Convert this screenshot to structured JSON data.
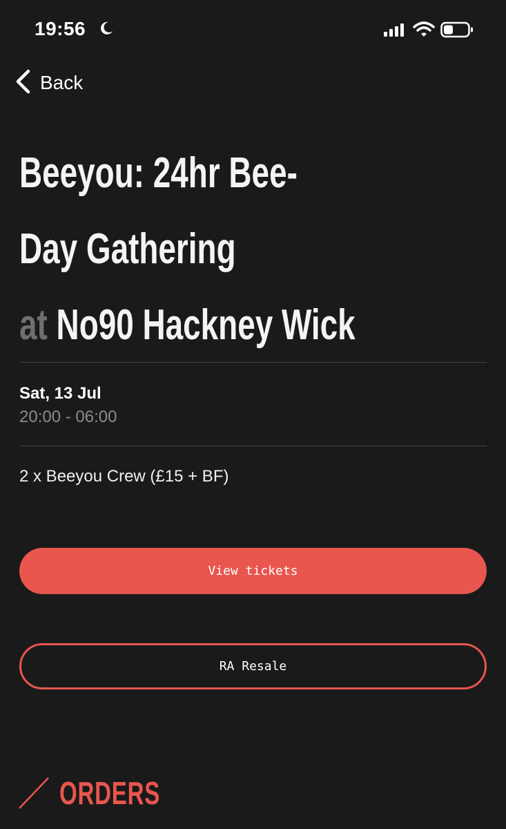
{
  "status_bar": {
    "time": "19:56",
    "moon_icon": "moon-icon",
    "signal_icon": "cellular-signal-icon",
    "wifi_icon": "wifi-icon",
    "battery_icon": "battery-icon"
  },
  "nav": {
    "back_label": "Back",
    "back_icon": "chevron-left-icon"
  },
  "event": {
    "title_line1": "Beeyou: 24hr Bee-",
    "title_line2": "Day Gathering",
    "venue_prefix": "at",
    "venue": "No90 Hackney Wick",
    "date": "Sat, 13 Jul",
    "time_range": "20:00 - 06:00",
    "ticket_info": "2 x Beeyou Crew (£15 + BF)"
  },
  "actions": {
    "view_tickets_label": "View tickets",
    "resale_label": "RA Resale"
  },
  "orders": {
    "heading": "ORDERS"
  },
  "colors": {
    "background": "#1a1a1a",
    "accent": "#e8564e",
    "muted_text": "#8c8c8c",
    "divider": "#444444"
  }
}
